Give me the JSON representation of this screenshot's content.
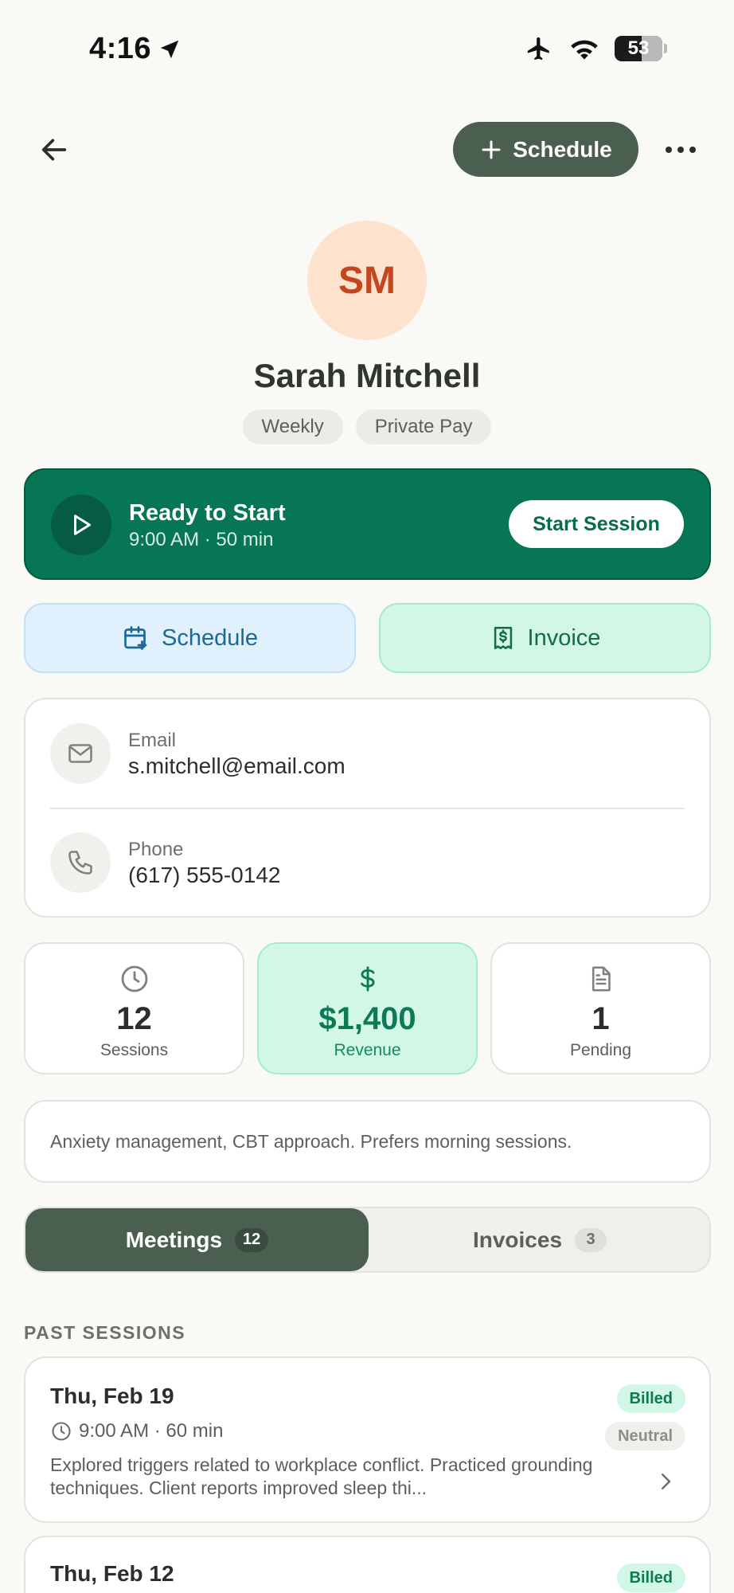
{
  "status_bar": {
    "time": "4:16",
    "battery": "53"
  },
  "nav": {
    "schedule_label": "Schedule"
  },
  "client": {
    "initials": "SM",
    "name": "Sarah Mitchell",
    "tags": [
      "Weekly",
      "Private Pay"
    ]
  },
  "ready": {
    "title": "Ready to Start",
    "subtitle": "9:00 AM · 50 min",
    "button": "Start Session"
  },
  "quick_actions": {
    "schedule": "Schedule",
    "invoice": "Invoice"
  },
  "contact": {
    "email_label": "Email",
    "email": "s.mitchell@email.com",
    "phone_label": "Phone",
    "phone": "(617) 555-0142"
  },
  "stats": [
    {
      "value": "12",
      "label": "Sessions"
    },
    {
      "value": "$1,400",
      "label": "Revenue"
    },
    {
      "value": "1",
      "label": "Pending"
    }
  ],
  "notes": "Anxiety management, CBT approach. Prefers morning sessions.",
  "tabs": [
    {
      "label": "Meetings",
      "count": "12"
    },
    {
      "label": "Invoices",
      "count": "3"
    }
  ],
  "sessions_title": "PAST SESSIONS",
  "sessions": [
    {
      "date": "Thu, Feb 19",
      "time": "9:00 AM · 60 min",
      "description": "Explored triggers related to workplace conflict. Practiced grounding techniques. Client reports improved sleep thi...",
      "billing": "Billed",
      "mood": "Neutral"
    },
    {
      "date": "Thu, Feb 12",
      "billing": "Billed"
    }
  ],
  "colors": {
    "primary_dark": "#4b5f51",
    "ready_green": "#077655",
    "accent_orange": "#c4461d"
  }
}
